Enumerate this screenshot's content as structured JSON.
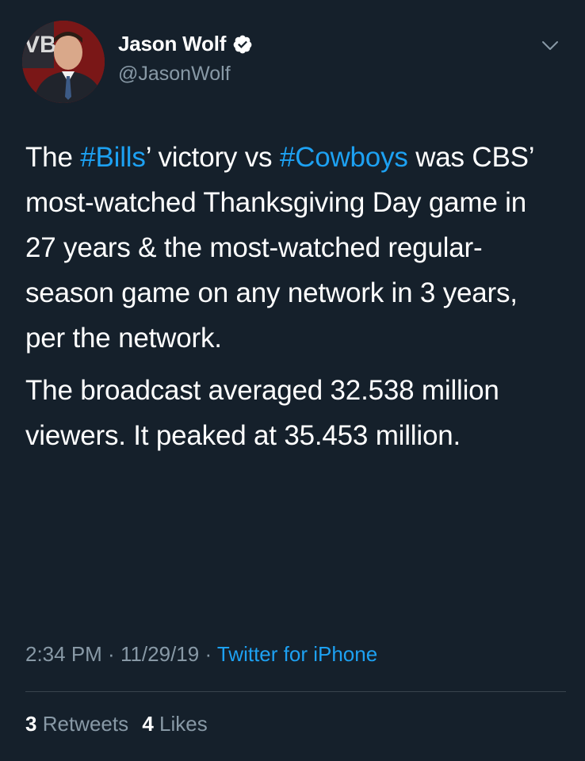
{
  "author": {
    "display_name": "Jason Wolf",
    "handle": "@JasonWolf",
    "verified": true,
    "avatar_logo_text": "VB"
  },
  "tweet": {
    "paragraph1": {
      "t1": "The ",
      "hashtag1": "#Bills",
      "t2": "’ victory vs ",
      "hashtag2": "#Cowboys",
      "t3": " was CBS’ most-watched Thanksgiving Day game in 27 years & the most-watched regular-season game on any network in 3 years, per the network."
    },
    "paragraph2": "The broadcast averaged 32.538 million viewers. It peaked at 35.453 million."
  },
  "meta": {
    "time": "2:34 PM",
    "separator1": " · ",
    "date": "11/29/19",
    "separator2": " · ",
    "source": "Twitter for iPhone"
  },
  "stats": {
    "retweets_count": "3",
    "retweets_label": "Retweets",
    "likes_count": "4",
    "likes_label": "Likes"
  },
  "colors": {
    "background": "#15202b",
    "text": "#ffffff",
    "secondary": "#8899a6",
    "accent": "#1da1f2",
    "divider": "#38444d"
  },
  "icons": {
    "verified": "verified-badge-icon",
    "more": "chevron-down-icon"
  }
}
